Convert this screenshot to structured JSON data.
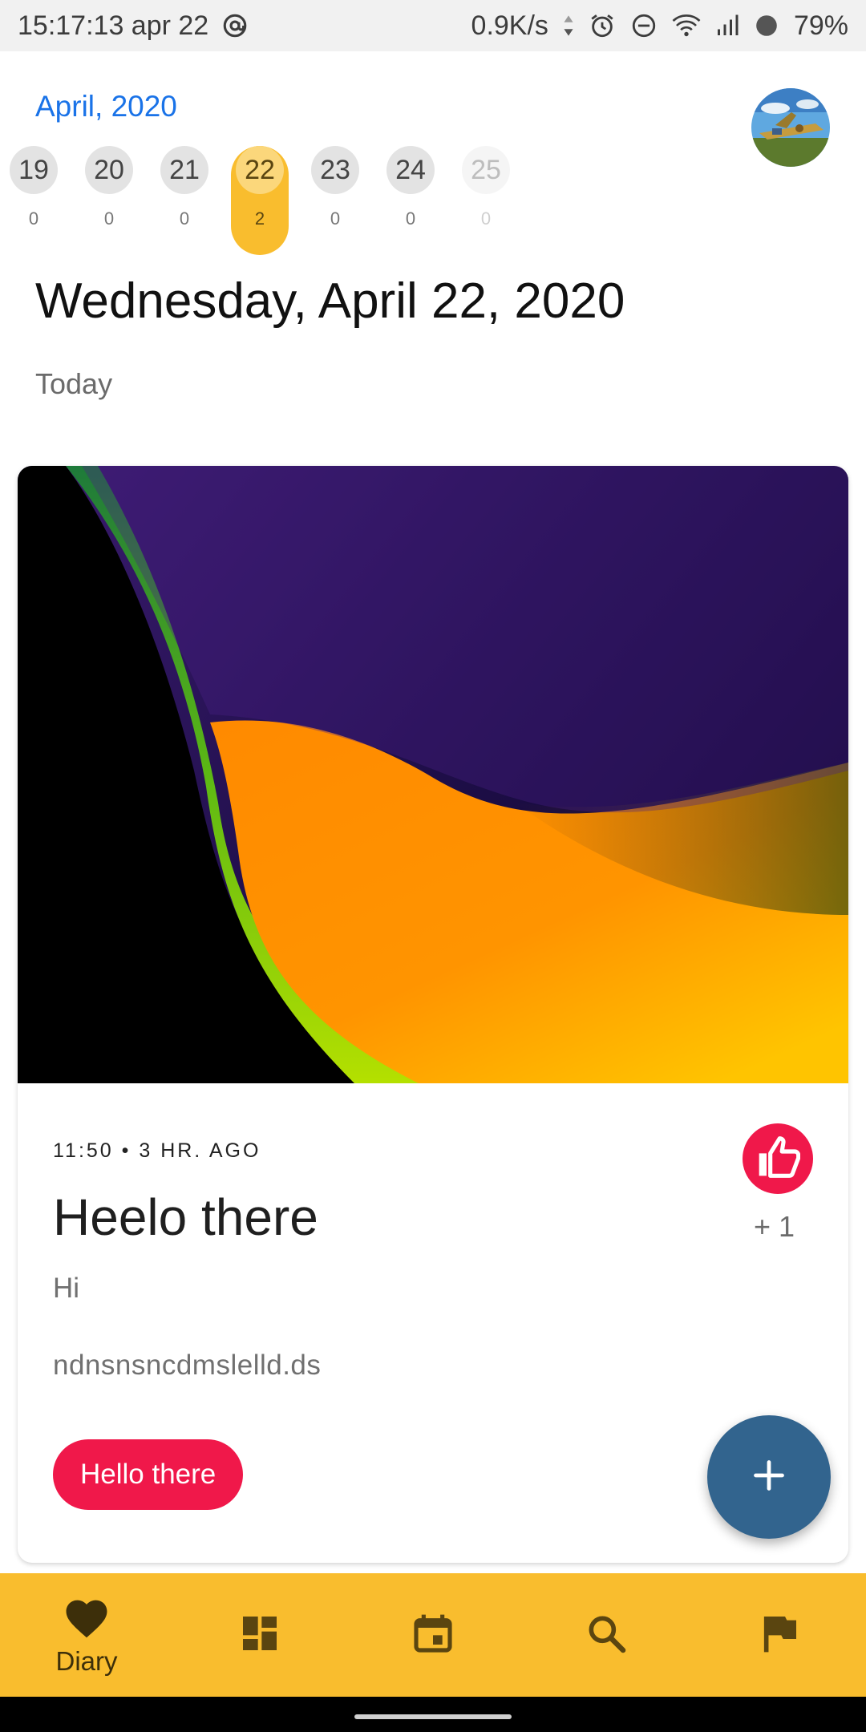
{
  "status_bar": {
    "time": "15:17:13 apr 22",
    "network_speed": "0.9K/s",
    "battery": "79%",
    "icons": [
      "at-sign-icon",
      "data-arrows-icon",
      "alarm-icon",
      "do-not-disturb-icon",
      "wifi-icon",
      "signal-icon",
      "battery-icon"
    ]
  },
  "header": {
    "month": "April, 2020",
    "avatar_icon": "profile-avatar"
  },
  "days": [
    {
      "num": "19",
      "count": "0"
    },
    {
      "num": "20",
      "count": "0"
    },
    {
      "num": "21",
      "count": "0"
    },
    {
      "num": "22",
      "count": "2",
      "selected": true
    },
    {
      "num": "23",
      "count": "0"
    },
    {
      "num": "24",
      "count": "0"
    },
    {
      "num": "25",
      "count": "0"
    }
  ],
  "date_title": "Wednesday, April 22, 2020",
  "date_subtitle": "Today",
  "entry": {
    "meta": "11:50 • 3 HR. AGO",
    "title": "Heelo there",
    "body_line1": "Hi",
    "body_line2": "ndnsnsncdmslelld.ds",
    "like_count": "+ 1",
    "tag": "Hello there",
    "like_icon": "thumbs-up-icon"
  },
  "fab_icon": "plus-icon",
  "bottom_nav": {
    "items": [
      {
        "icon": "heart-icon",
        "label": "Diary"
      },
      {
        "icon": "dashboard-icon",
        "label": ""
      },
      {
        "icon": "calendar-icon",
        "label": ""
      },
      {
        "icon": "search-icon",
        "label": ""
      },
      {
        "icon": "flag-icon",
        "label": ""
      }
    ]
  },
  "colors": {
    "accent_yellow": "#f9bd2e",
    "accent_red": "#f0184a",
    "fab_blue": "#32648e",
    "link_blue": "#1a73e8"
  }
}
